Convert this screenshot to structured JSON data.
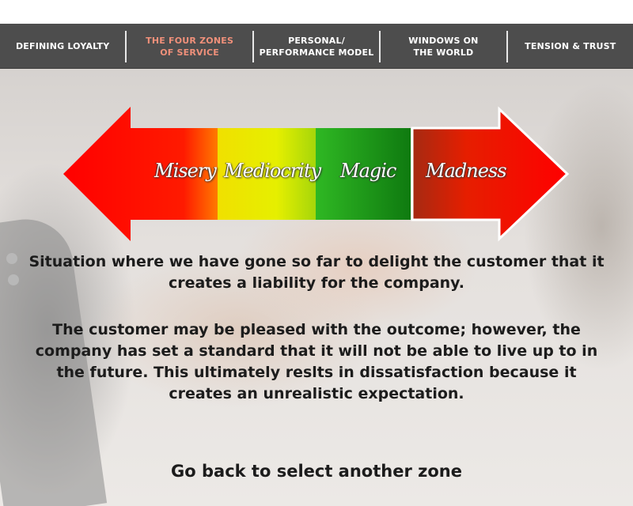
{
  "nav": {
    "items": [
      {
        "label": "DEFINING LOYALTY"
      },
      {
        "label": "THE FOUR ZONES\nOF SERVICE"
      },
      {
        "label": "PERSONAL/\nPERFORMANCE MODEL"
      },
      {
        "label": "WINDOWS ON\nTHE WORLD"
      },
      {
        "label": "TENSION & TRUST"
      }
    ],
    "active_color": "#f0907a"
  },
  "zones": {
    "misery": "Misery",
    "mediocrity": "Mediocrity",
    "magic": "Magic",
    "madness": "Madness",
    "selected": "Madness",
    "colors": {
      "misery": "#ff2a00",
      "mediocrity": "#e8e800",
      "magic": "#1ea81e",
      "madness": "#e00000"
    }
  },
  "description": {
    "paragraph1": "Situation where we have gone so far to delight the customer that it creates a liability for the company.",
    "paragraph2": "The customer may be pleased with the outcome; however, the company has set a standard that it will not be able to live up to in the future. This ultimately reslts in dissatisfaction because it creates an unrealistic expectation."
  },
  "go_back": "Go back to select another zone"
}
